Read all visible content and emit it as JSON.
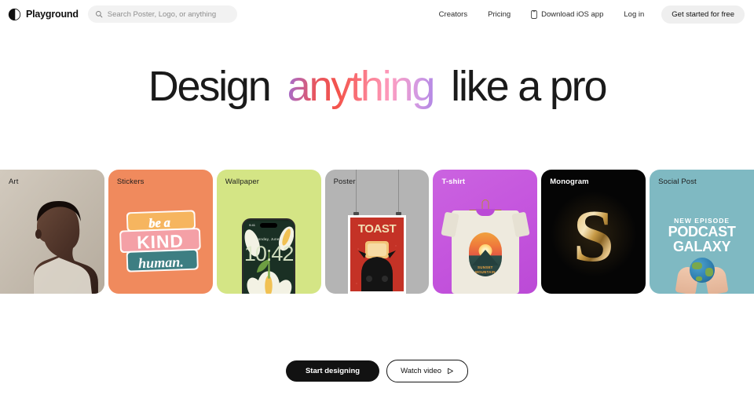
{
  "nav": {
    "brand": "Playground",
    "brand_icon": "playground-logo-icon",
    "search": {
      "icon": "search-icon",
      "placeholder": "Search Poster, Logo, or anything",
      "value": ""
    },
    "links": [
      {
        "label": "Creators"
      },
      {
        "label": "Pricing"
      },
      {
        "label": "Download iOS app",
        "icon": "phone-icon"
      },
      {
        "label": "Log in"
      }
    ],
    "cta": "Get started for free"
  },
  "hero": {
    "word1": "Design",
    "word2": "anything",
    "word3": "like a pro",
    "accent_gradient": [
      "#a06fd6",
      "#f4544c",
      "#fd9cc0",
      "#b086e4"
    ]
  },
  "cards": [
    {
      "label": "Art",
      "label_style": "dark",
      "bg": "#c6bdb0",
      "art": "portrait-profile-photo"
    },
    {
      "label": "Stickers",
      "label_style": "dark",
      "bg": "#f08a5d",
      "art": "be-a-kind-human-sticker",
      "sticker_lines": [
        "be a",
        "KIND",
        "human."
      ]
    },
    {
      "label": "Wallpaper",
      "label_style": "dark",
      "bg": "#d4e585",
      "art": "phone-lockscreen-tulips",
      "phone": {
        "status": "9:41",
        "date": "Monday, June 8",
        "time": "10:42"
      }
    },
    {
      "label": "Poster",
      "label_style": "dark",
      "bg": "#b4b4b4",
      "art": "hanging-toast-cat-poster",
      "poster_title": "TOAST"
    },
    {
      "label": "T-shirt",
      "label_style": "light",
      "bg": "#c454dd",
      "art": "tshirt-on-hanger-sunset-graphic",
      "tee_line1": "SUNSET",
      "tee_line2": "MOUNTAIN"
    },
    {
      "label": "Monogram",
      "label_style": "light",
      "bg": "#050505",
      "art": "ornate-gold-letter",
      "letter": "S"
    },
    {
      "label": "Social Post",
      "label_style": "dark",
      "bg": "#7fb9c2",
      "art": "podcast-galaxy-hands-globe",
      "kicker": "NEW EPISODE",
      "title_l1": "PODCAST",
      "title_l2": "GALAXY"
    }
  ],
  "actions": {
    "primary": "Start designing",
    "secondary": "Watch video",
    "secondary_icon": "play-icon"
  }
}
